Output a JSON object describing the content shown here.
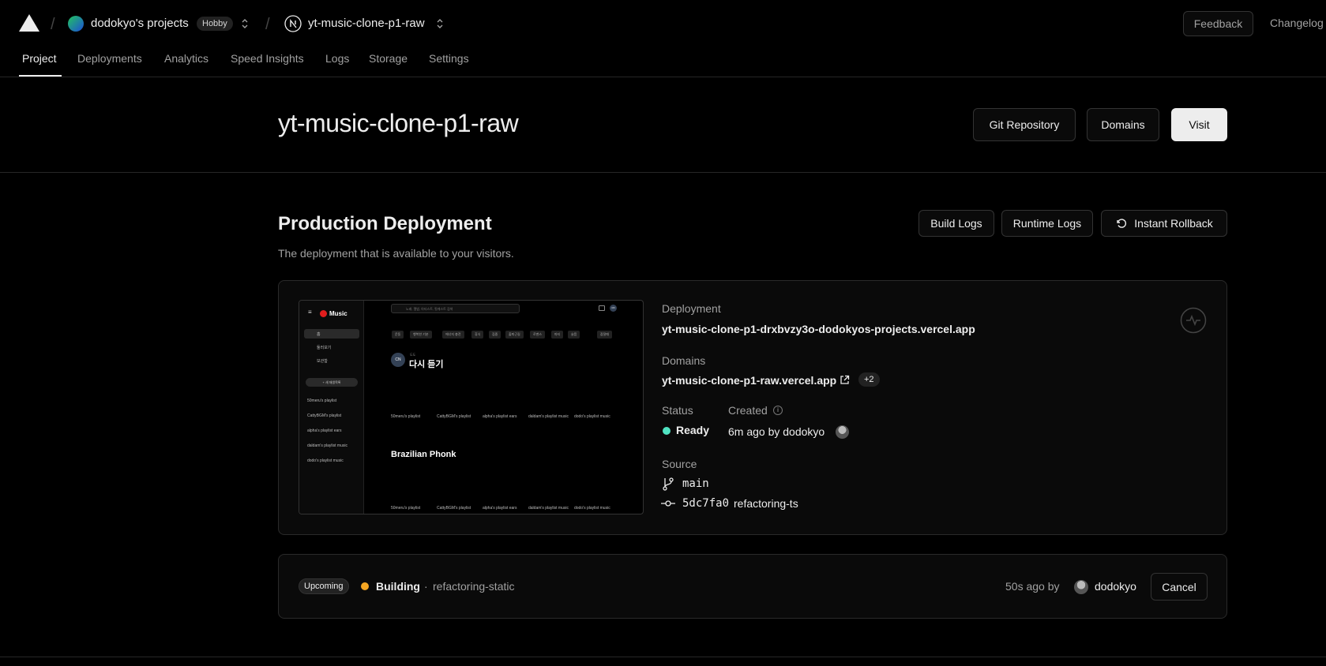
{
  "topbar": {
    "team_name": "dodokyo's projects",
    "plan_badge": "Hobby",
    "project_name": "yt-music-clone-p1-raw",
    "feedback_label": "Feedback",
    "changelog_label": "Changelog"
  },
  "tabs": [
    {
      "label": "Project",
      "active": true
    },
    {
      "label": "Deployments"
    },
    {
      "label": "Analytics"
    },
    {
      "label": "Speed Insights"
    },
    {
      "label": "Logs"
    },
    {
      "label": "Storage"
    },
    {
      "label": "Settings"
    }
  ],
  "header": {
    "title": "yt-music-clone-p1-raw",
    "git_repository_label": "Git Repository",
    "domains_label": "Domains",
    "visit_label": "Visit"
  },
  "production": {
    "title": "Production Deployment",
    "subtitle": "The deployment that is available to your visitors.",
    "build_logs_label": "Build Logs",
    "runtime_logs_label": "Runtime Logs",
    "rollback_label": "Instant Rollback",
    "deployment_label": "Deployment",
    "deployment_url": "yt-music-clone-p1-drxbvzy3o-dodokyos-projects.vercel.app",
    "domains_label": "Domains",
    "domain_url": "yt-music-clone-p1-raw.vercel.app",
    "domain_more": "+2",
    "status_label": "Status",
    "status_value": "Ready",
    "status_color": "#50e3c2",
    "created_label": "Created",
    "created_value": "6m ago by dodokyo",
    "source_label": "Source",
    "branch": "main",
    "commit_hash": "5dc7fa0",
    "commit_message": "refactoring-ts"
  },
  "preview": {
    "brand": "Music",
    "search_placeholder": "노래, 앨범, 아티스트, 팟캐스트 검색",
    "nav": [
      "홈",
      "둘러보기",
      "보관함"
    ],
    "new_playlist": "+ 새 재생목록",
    "sidebar_playlists": [
      "50meru's playlist",
      "CattyBGM's playlist",
      "alpha's playlist ears",
      "daldam's playlist music",
      "dodo's playlist music"
    ],
    "chips": [
      "운동",
      "행복한 기분",
      "에너지 충전",
      "휴식",
      "집중",
      "출퇴근길",
      "로맨스",
      "파티",
      "슬픔",
      "잠잘때"
    ],
    "section1_small": "도도",
    "section1_title": "다시 듣기",
    "section2_title": "Brazilian Phonk",
    "avatar": "CN",
    "cards": [
      "50meru's playlist",
      "CattyBGM's playlist",
      "alpha's playlist ears",
      "daldam's playlist music",
      "dodo's playlist music"
    ]
  },
  "upcoming": {
    "badge": "Upcoming",
    "status": "Building",
    "status_color": "#f5a623",
    "separator": "·",
    "branch": "refactoring-static",
    "time": "50s ago by",
    "user": "dodokyo",
    "cancel_label": "Cancel"
  }
}
